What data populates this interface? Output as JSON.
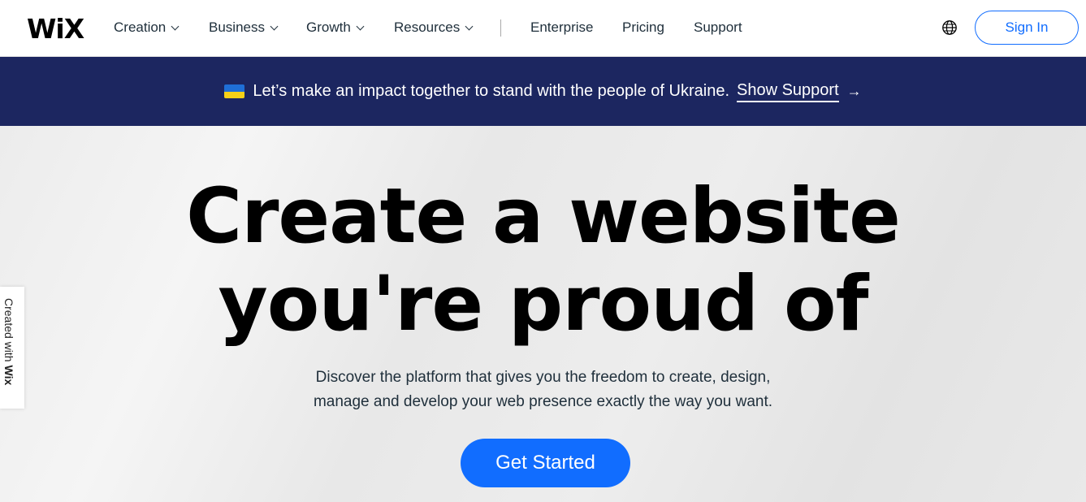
{
  "header": {
    "logo": "WiX",
    "nav": [
      {
        "label": "Creation",
        "has_dropdown": true
      },
      {
        "label": "Business",
        "has_dropdown": true
      },
      {
        "label": "Growth",
        "has_dropdown": true
      },
      {
        "label": "Resources",
        "has_dropdown": true
      },
      {
        "label": "Enterprise",
        "has_dropdown": false
      },
      {
        "label": "Pricing",
        "has_dropdown": false
      },
      {
        "label": "Support",
        "has_dropdown": false
      }
    ],
    "language_icon": "globe-icon",
    "sign_in_label": "Sign In"
  },
  "banner": {
    "flag_icon": "ukraine-flag-icon",
    "message": "Let’s make an impact together to stand with the people of Ukraine.",
    "link_label": "Show Support",
    "arrow": "→"
  },
  "hero": {
    "title_line1": "Create a website",
    "title_line2": "you're proud of",
    "subtitle_line1": "Discover the platform that gives you the freedom to create, design,",
    "subtitle_line2": "manage and develop your web presence exactly the way you want.",
    "cta_label": "Get Started"
  },
  "badge": {
    "prefix": "Created with ",
    "brand": "Wix"
  },
  "colors": {
    "accent": "#116dff",
    "banner_bg": "#1c2660",
    "text_dark": "#20303c"
  }
}
